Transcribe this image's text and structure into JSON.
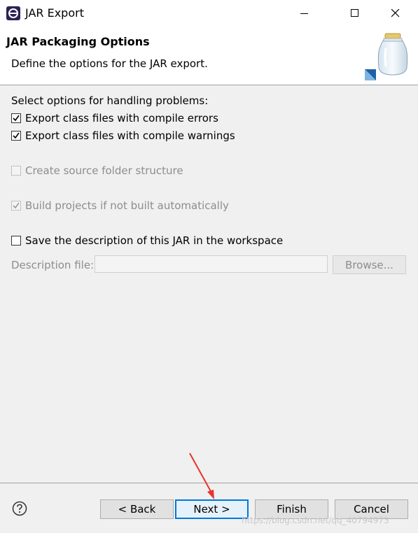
{
  "window": {
    "title": "JAR Export",
    "icons": {
      "app": "eclipse-icon",
      "minimize": "minimize-icon",
      "maximize": "maximize-icon",
      "close": "close-icon"
    }
  },
  "header": {
    "title": "JAR Packaging Options",
    "description": "Define the options for the JAR export.",
    "banner_icon": "jar-icon"
  },
  "options": {
    "section_label": "Select options for handling problems:",
    "export_errors": {
      "label": "Export class files with compile errors",
      "checked": true,
      "enabled": true
    },
    "export_warnings": {
      "label": "Export class files with compile warnings",
      "checked": true,
      "enabled": true
    },
    "source_folder": {
      "label": "Create source folder structure",
      "checked": false,
      "enabled": false
    },
    "build_projects": {
      "label": "Build projects if not built automatically",
      "checked": true,
      "enabled": false
    },
    "save_description": {
      "label": "Save the description of this JAR in the workspace",
      "checked": false,
      "enabled": true
    }
  },
  "description_file": {
    "label": "Description file:",
    "value": "",
    "browse_label": "Browse..."
  },
  "footer": {
    "help_icon": "help-icon",
    "back_label": "< Back",
    "next_label": "Next >",
    "finish_label": "Finish",
    "cancel_label": "Cancel"
  },
  "watermark": "https://blog.csdn.net/qq_40794973",
  "colors": {
    "accent": "#0078d7",
    "annotation_arrow": "#e8332b"
  }
}
